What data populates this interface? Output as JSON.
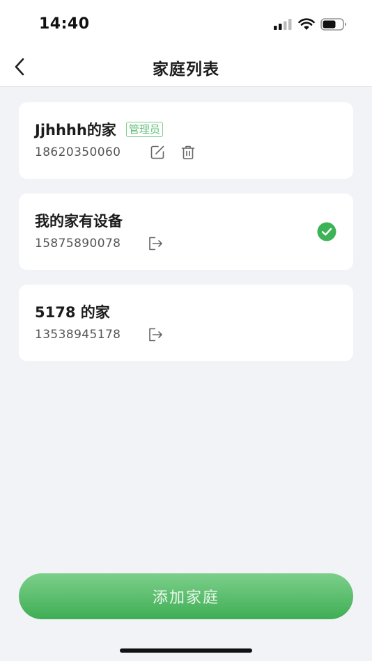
{
  "status_bar": {
    "time": "14:40"
  },
  "nav": {
    "title": "家庭列表"
  },
  "families": [
    {
      "name": "Jjhhhh的家",
      "badge": "管理员",
      "phone": "18620350060",
      "actions": [
        "edit-icon",
        "trash-icon"
      ],
      "selected": false
    },
    {
      "name": "我的家有设备",
      "badge": "",
      "phone": "15875890078",
      "actions": [
        "exit-icon"
      ],
      "selected": true
    },
    {
      "name": "5178 的家",
      "badge": "",
      "phone": "13538945178",
      "actions": [
        "exit-icon"
      ],
      "selected": false
    }
  ],
  "add_button": {
    "label": "添加家庭"
  },
  "colors": {
    "accent": "#3fae55",
    "badge": "#5fbf76",
    "background": "#f2f3f7"
  }
}
